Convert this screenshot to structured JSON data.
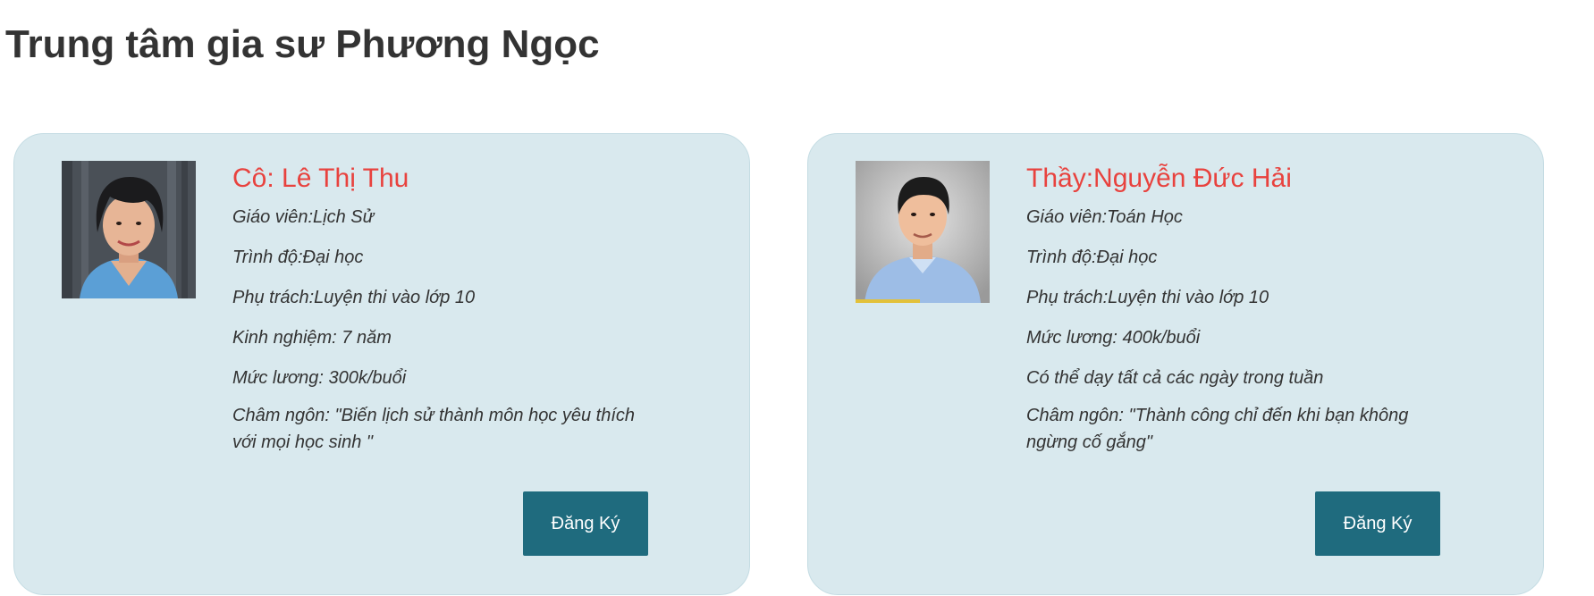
{
  "page": {
    "title": "Trung tâm gia sư Phương Ngọc"
  },
  "colors": {
    "card_bg": "#d9e9ee",
    "name_red": "#e8423e",
    "button_teal": "#1f6b7e",
    "text_dark": "#333333"
  },
  "tutors": [
    {
      "name": "Cô: Lê Thị Thu",
      "lines": [
        "Giáo viên:Lịch Sử",
        "Trình độ:Đại học",
        "Phụ trách:Luyện thi vào lớp 10",
        "Kinh nghiệm: 7 năm",
        "Mức lương: 300k/buổi"
      ],
      "motto": "Châm ngôn: \"Biến lịch sử thành môn học yêu thích với mọi học sinh \"",
      "button_label": "Đăng Ký",
      "photo": "portrait-woman-icon"
    },
    {
      "name": "Thầy:Nguyễn Đức Hải",
      "lines": [
        "Giáo viên:Toán Học",
        "Trình độ:Đại học",
        "Phụ trách:Luyện thi vào lớp 10",
        "Mức lương: 400k/buổi",
        "Có thể dạy tất cả các ngày trong tuần"
      ],
      "motto": "Châm ngôn: \"Thành công chỉ đến khi bạn không ngừng cố gắng\"",
      "button_label": "Đăng Ký",
      "photo": "portrait-man-icon"
    }
  ]
}
